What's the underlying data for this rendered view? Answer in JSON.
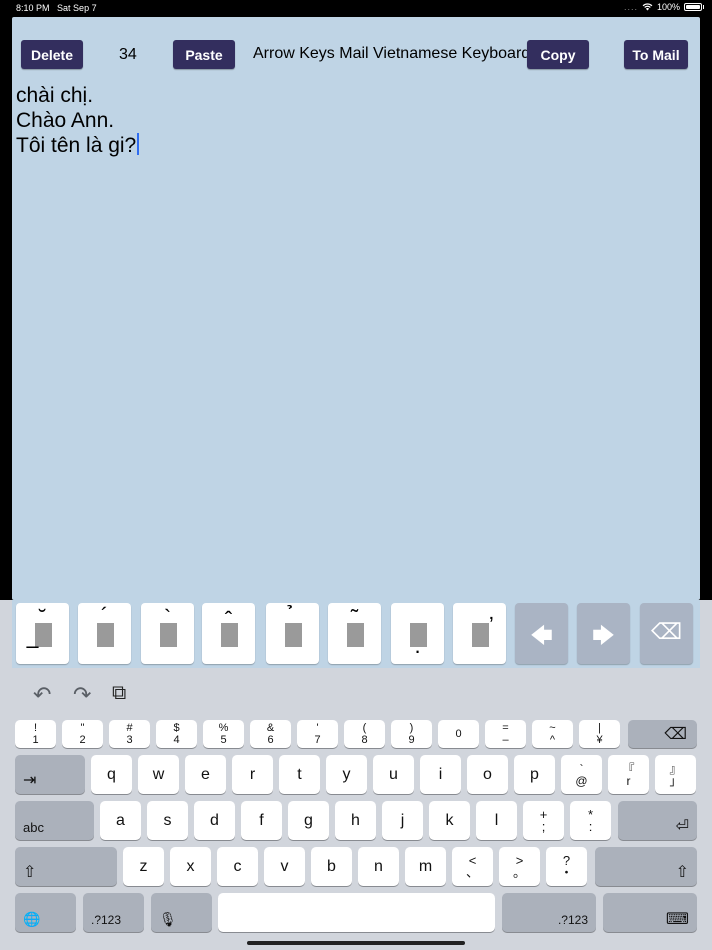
{
  "status": {
    "time": "8:10 PM",
    "date": "Sat Sep 7",
    "dots": "....",
    "wifi": "wifi-icon",
    "battery": "100%"
  },
  "app": {
    "delete_label": "Delete",
    "count": "34",
    "paste_label": "Paste",
    "title": "Arrow Keys Mail Vietnamese Keyboard",
    "copy_label": "Copy",
    "to_mail_label": "To Mail",
    "text_lines": [
      "chài chị.",
      "Chào Ann.",
      "Tôi tên là gi?"
    ],
    "colors": {
      "background": "#bfd4e5",
      "button": "#332e5e",
      "caret": "#2f6cf0"
    }
  },
  "accent_keys": [
    {
      "top": "˘",
      "bottom": "–"
    },
    {
      "top": "´"
    },
    {
      "top": "`"
    },
    {
      "top": "ˆ"
    },
    {
      "top": "̉"
    },
    {
      "top": "˜"
    },
    {
      "bottom": "."
    },
    {
      "side": "ʼ"
    }
  ],
  "accent_nav": {
    "left": "🡄",
    "right": "🡆",
    "backspace": "⌫"
  },
  "toolbar": {
    "undo": "↶",
    "redo": "↷",
    "paste_icon": "⧉"
  },
  "keys": {
    "row1": [
      {
        "top": "!",
        "bottom": "1"
      },
      {
        "top": "\"",
        "bottom": "2"
      },
      {
        "top": "#",
        "bottom": "3"
      },
      {
        "top": "$",
        "bottom": "4"
      },
      {
        "top": "%",
        "bottom": "5"
      },
      {
        "top": "&",
        "bottom": "6"
      },
      {
        "top": "'",
        "bottom": "7"
      },
      {
        "top": "(",
        "bottom": "8"
      },
      {
        "top": ")",
        "bottom": "9"
      },
      {
        "top": "",
        "bottom": "0"
      },
      {
        "top": "=",
        "bottom": "–"
      },
      {
        "top": "~",
        "bottom": "^"
      },
      {
        "top": "|",
        "bottom": "¥"
      }
    ],
    "row2": [
      "q",
      "w",
      "e",
      "r",
      "t",
      "y",
      "u",
      "i",
      "o",
      "p"
    ],
    "row2_extra": [
      {
        "top": "`",
        "bottom": "@"
      },
      {
        "top": "『",
        "bottom": "r"
      },
      {
        "top": "』",
        "bottom": "」"
      }
    ],
    "row3": [
      "a",
      "s",
      "d",
      "f",
      "g",
      "h",
      "j",
      "k",
      "l"
    ],
    "row3_extra": [
      {
        "top": "+",
        "bottom": ";"
      },
      {
        "top": "*",
        "bottom": ":"
      }
    ],
    "row4": [
      "z",
      "x",
      "c",
      "v",
      "b",
      "n",
      "m"
    ],
    "row4_extra": [
      {
        "top": "<",
        "bottom": "、"
      },
      {
        "top": ">",
        "bottom": "。"
      },
      {
        "top": "?",
        "bottom": "・"
      }
    ],
    "tab_label": "⇥",
    "abc_label": "abc",
    "shift_label": "⇧",
    "return_label": "⏎",
    "num_label": ".?123",
    "globe_label": "🌐",
    "mic_label": "🎙",
    "dismiss_label": "⌨",
    "delete_label": "⌫"
  }
}
